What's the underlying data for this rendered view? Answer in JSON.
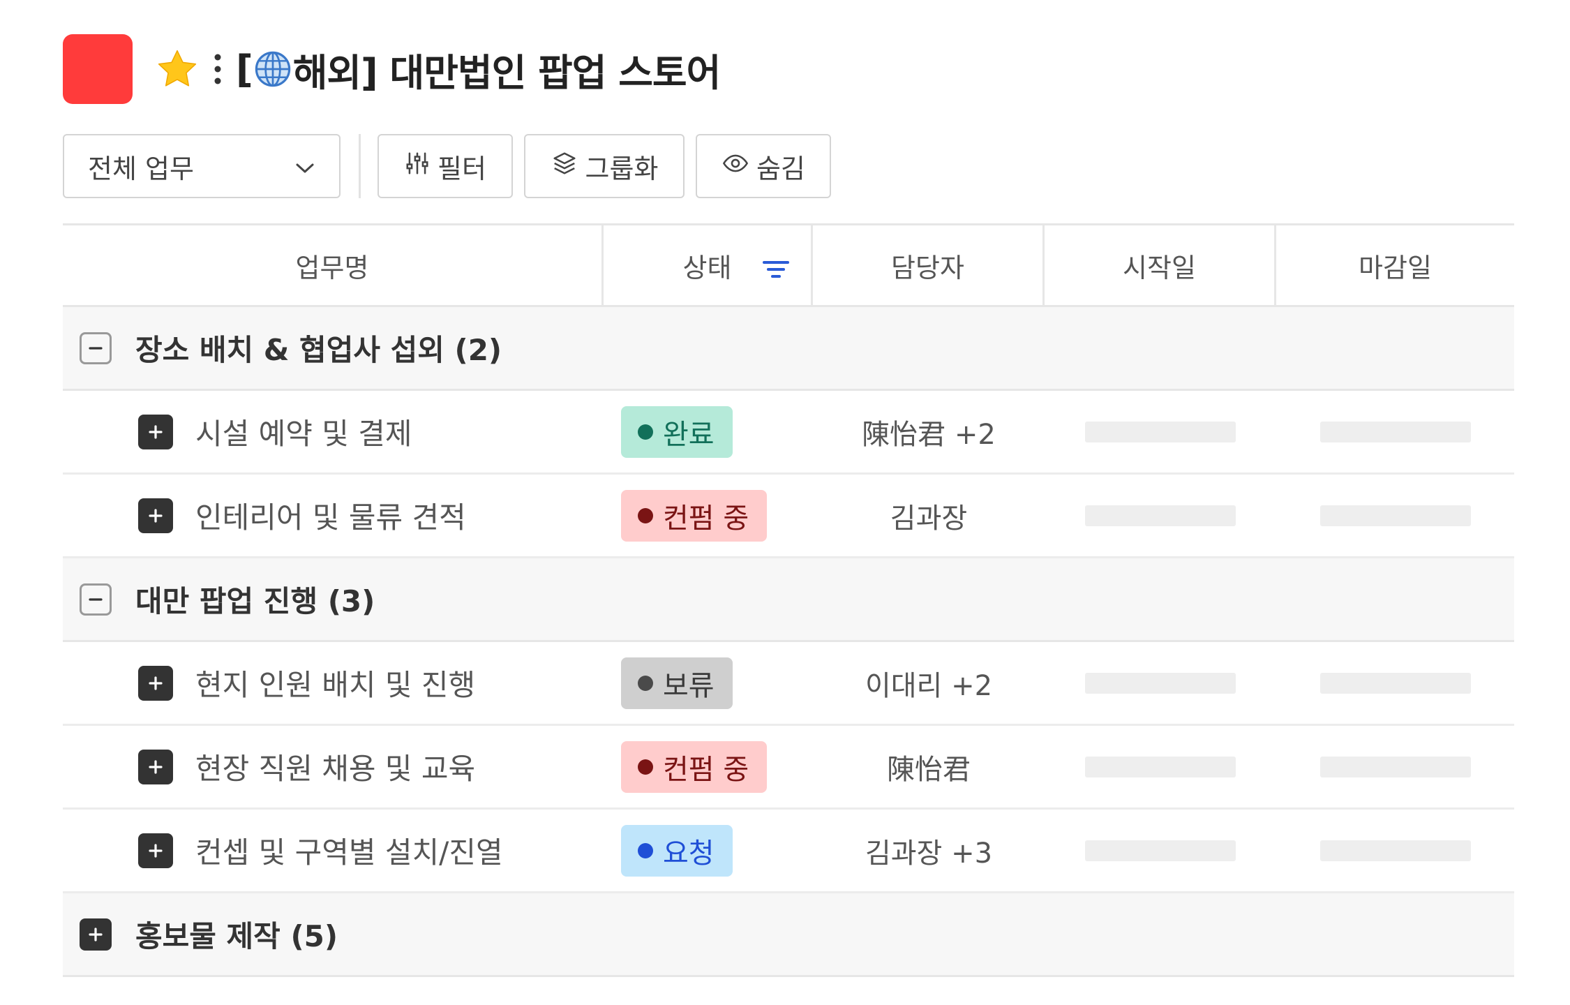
{
  "header": {
    "title_prefix": "[",
    "title_rest": "해외] 대만법인 팝업 스토어",
    "icon_color": "#ff3b3b",
    "star_color": "#ffc61a"
  },
  "toolbar": {
    "view_select": "전체 업무",
    "filter_label": "필터",
    "group_label": "그룹화",
    "hide_label": "숨김"
  },
  "table": {
    "columns": [
      "업무명",
      "상태",
      "담당자",
      "시작일",
      "마감일"
    ],
    "groups": [
      {
        "label": "장소 배치 & 협업사 섭외 (2)",
        "expanded": true,
        "tasks": [
          {
            "name": "시설 예약 및 결제",
            "status": "완료",
            "assignee": "陳怡君 +2"
          },
          {
            "name": "인테리어 및 물류 견적",
            "status": "컨펌 중",
            "assignee": "김과장"
          }
        ]
      },
      {
        "label": "대만 팝업 진행 (3)",
        "expanded": true,
        "tasks": [
          {
            "name": "현지 인원 배치 및 진행",
            "status": "보류",
            "assignee": "이대리 +2"
          },
          {
            "name": "현장 직원 채용 및 교육",
            "status": "컨펌 중",
            "assignee": "陳怡君"
          },
          {
            "name": "컨셉 및 구역별 설치/진열",
            "status": "요청",
            "assignee": "김과장 +3"
          }
        ]
      },
      {
        "label": "홍보물 제작 (5)",
        "expanded": false,
        "tasks": []
      }
    ]
  },
  "status_colors": {
    "완료": {
      "bg": "#b5ead9",
      "dot": "#12705a",
      "text": "#12705a"
    },
    "컨펌 중": {
      "bg": "#ffcccc",
      "dot": "#7a1414",
      "text": "#7a1414"
    },
    "보류": {
      "bg": "#cfcfcf",
      "dot": "#4a4a4a",
      "text": "#3a3a3a"
    },
    "요청": {
      "bg": "#bfe5fb",
      "dot": "#1f4fd6",
      "text": "#1f4fd6"
    }
  }
}
